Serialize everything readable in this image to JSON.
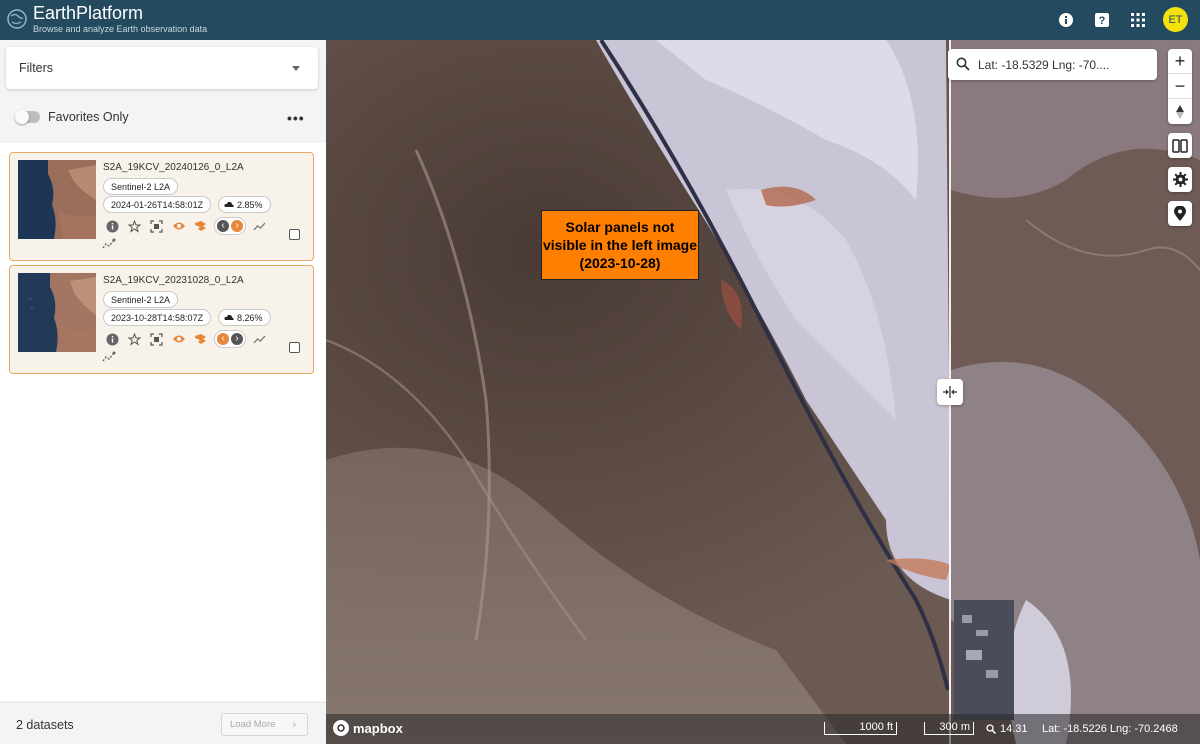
{
  "app": {
    "title": "EarthPlatform",
    "subtitle": "Browse and analyze Earth observation data",
    "avatar_initials": "ET"
  },
  "header_icons": [
    "info-icon",
    "help-icon",
    "apps-grid-icon"
  ],
  "sidebar": {
    "filters_label": "Filters",
    "favorites_label": "Favorites Only",
    "favorites_on": false,
    "more_label": "•••",
    "datasets": [
      {
        "title": "S2A_19KCV_20240126_0_L2A",
        "collection": "Sentinel-2 L2A",
        "datetime": "2024-01-26T14:58:01Z",
        "cloud": "2.85%",
        "selected": false
      },
      {
        "title": "S2A_19KCV_20231028_0_L2A",
        "collection": "Sentinel-2 L2A",
        "datetime": "2023-10-28T14:58:07Z",
        "cloud": "8.26%",
        "selected": false
      }
    ],
    "count_label": "2 datasets",
    "load_more_label": "Load More"
  },
  "map": {
    "search_value": "Lat: -18.5329 Lng: -70....",
    "annotation": "Solar panels not visible in the left image (2023-10-28)",
    "attribution": "mapbox",
    "scale_ft": "1000 ft",
    "scale_m": "300 m",
    "zoom": "14.31",
    "cursor": "Lat: -18.5226   Lng: -70.2468",
    "colors": {
      "accent": "#e8873a",
      "header": "#234a5f",
      "annotation": "#ff7f00"
    }
  }
}
